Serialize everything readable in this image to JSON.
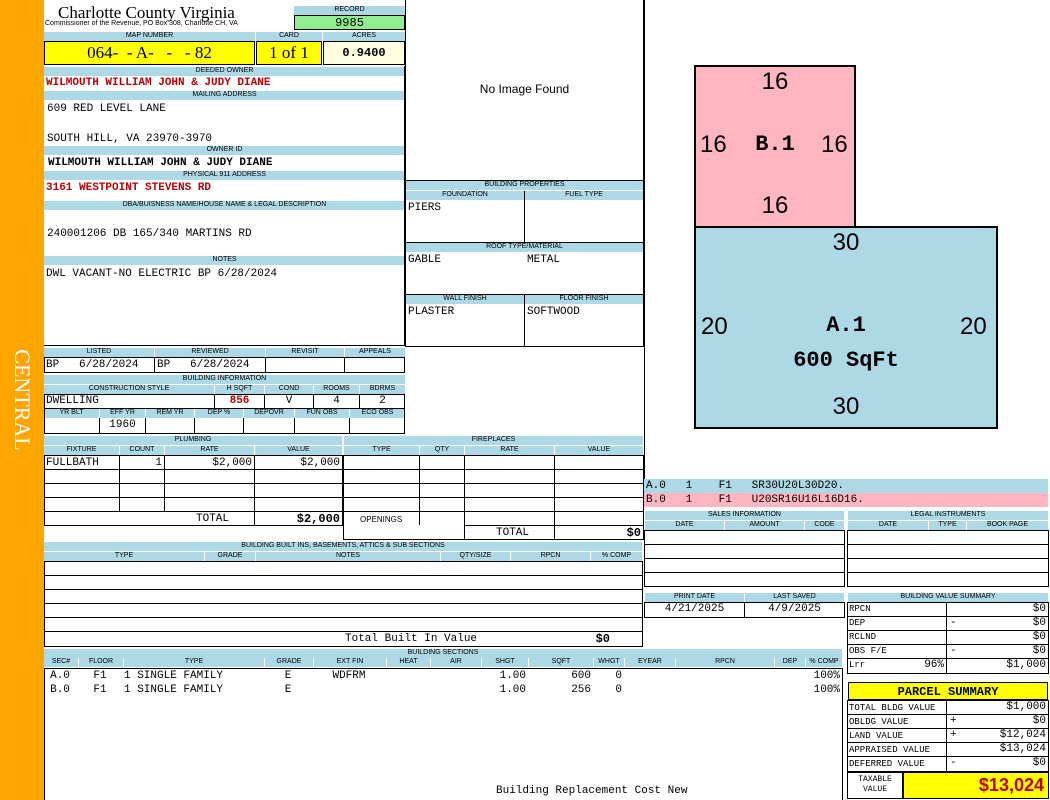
{
  "sidebar": {
    "label": "CENTRAL",
    "color": "#ffa500"
  },
  "header": {
    "title": "Charlotte County Virginia",
    "subtitle": "Commissioner of the Revenue, PO Box 308, Charlotte CH, VA",
    "record_label": "RECORD",
    "record_value": "9985",
    "map_label": "MAP NUMBER",
    "map_value": "064-  - A-   -   - 82",
    "card_label": "CARD",
    "card_value": "1 of 1",
    "acres_label": "ACRES",
    "acres_value": "0.9400"
  },
  "owner": {
    "deeded_label": "DEEDED OWNER",
    "deeded_value": "WILMOUTH WILLIAM JOHN & JUDY DIANE",
    "mailing_label": "MAILING ADDRESS",
    "mailing_line1": "609 RED LEVEL LANE",
    "mailing_line2": "SOUTH HILL, VA 23970-3970",
    "owner_id_label": "OWNER ID",
    "owner_id_value": "WILMOUTH WILLIAM JOHN & JUDY DIANE",
    "physical_label": "PHYSICAL 911 ADDRESS",
    "physical_value": "3161 WESTPOINT STEVENS RD",
    "dba_label": "DBA/BUISNESS NAME/HOUSE NAME & LEGAL DESCRIPTION",
    "dba_value": "240001206 DB 165/340 MARTINS RD",
    "notes_label": "NOTES",
    "notes_value": "DWL VACANT-NO ELECTRIC BP 6/28/2024"
  },
  "image": {
    "placeholder": "No Image Found"
  },
  "building_properties": {
    "title": "BUILDING PROPERTIES",
    "foundation_label": "FOUNDATION",
    "foundation_value": "PIERS",
    "fuel_label": "FUEL TYPE",
    "fuel_value": "",
    "roof_label": "ROOF TYPE/MATERIAL",
    "roof_type": "GABLE",
    "roof_material": "METAL",
    "wall_label": "WALL FINISH",
    "wall_value": "PLASTER",
    "floor_label": "FLOOR FINISH",
    "floor_value": "SOFTWOOD"
  },
  "sketch": {
    "b1": {
      "label": "B.1",
      "top": "16",
      "left": "16",
      "right": "16",
      "bottom": "16",
      "color": "#ffb6c1"
    },
    "a1": {
      "label": "A.1",
      "area": "600 SqFt",
      "top": "30",
      "left": "20",
      "right": "20",
      "bottom": "30",
      "color": "#add8e6"
    },
    "legend": [
      {
        "text": "A.0   1    F1   SR30U20L30D20.",
        "color": "#add8e6"
      },
      {
        "text": "B.0   1    F1   U20SR16U16L16D16.",
        "color": "#ffb6c1"
      }
    ]
  },
  "review": {
    "listed_label": "LISTED",
    "listed_value": "BP   6/28/2024",
    "reviewed_label": "REVIEWED",
    "reviewed_value": "BP   6/28/2024",
    "revisit_label": "REVISIT",
    "appeals_label": "APPEALS"
  },
  "building_info": {
    "title": "BUILDING INFORMATION",
    "style_label": "CONSTRUCTION STYLE",
    "style_value": "DWELLING",
    "hsqft_label": "H SQFT",
    "hsqft_value": "856",
    "cond_label": "COND",
    "cond_value": "V",
    "rooms_label": "ROOMS",
    "rooms_value": "4",
    "bdrms_label": "BDRMS",
    "bdrms_value": "2",
    "yrblt_label": "YR BLT",
    "effyr_label": "EFF YR",
    "effyr_value": "1960",
    "remyr_label": "REM YR",
    "dep_label": "DEP %",
    "depovr_label": "DEPOVR",
    "funobs_label": "FUN OBS",
    "ecoobs_label": "ECO OBS"
  },
  "plumbing": {
    "title": "PLUMBING",
    "cols": [
      "FIXTURE",
      "COUNT",
      "RATE",
      "VALUE"
    ],
    "row_fixture": "FULLBATH",
    "row_count": "1",
    "row_rate": "$2,000",
    "row_value": "$2,000",
    "total_label": "TOTAL",
    "total_value": "$2,000"
  },
  "fireplaces": {
    "title": "FIREPLACES",
    "cols": [
      "TYPE",
      "QTY",
      "RATE",
      "VALUE"
    ],
    "openings_label": "OPENINGS",
    "total_label": "TOTAL",
    "total_value": "$0"
  },
  "sales": {
    "title": "SALES INFORMATION",
    "cols": [
      "DATE",
      "AMOUNT",
      "CODE"
    ]
  },
  "legal": {
    "title": "LEGAL INSTRUMENTS",
    "cols": [
      "DATE",
      "TYPE",
      "BOOK PAGE"
    ]
  },
  "print": {
    "print_label": "PRINT DATE",
    "print_value": "4/21/2025",
    "saved_label": "LAST SAVED",
    "saved_value": "4/9/2025"
  },
  "builtins": {
    "title": "BUILDING BUILT INS, BASEMENTS, ATTICS & SUB SECTIONS",
    "cols": [
      "TYPE",
      "GRADE",
      "NOTES",
      "QTY/SIZE",
      "RPCN",
      "% COMP"
    ],
    "total_label": "Total Built In Value",
    "total_value": "$0"
  },
  "value_summary": {
    "title": "BUILDING VALUE SUMMARY",
    "rpcn_label": "RPCN",
    "rpcn_value": "$0",
    "dep_label": "DEP",
    "dep_sign": "-",
    "dep_value": "$0",
    "rclnd_label": "RCLND",
    "rclnd_value": "$0",
    "obs_label": "OBS F/E",
    "obs_sign": "-",
    "obs_value": "$0",
    "lrr_label": "Lrr",
    "lrr_pct": "96%",
    "lrr_value": "$1,000"
  },
  "parcel_summary": {
    "title": "PARCEL SUMMARY",
    "total_bldg_label": "TOTAL BLDG VALUE",
    "total_bldg_value": "$1,000",
    "obldg_label": "OBLDG VALUE",
    "obldg_sign": "+",
    "obldg_value": "$0",
    "land_label": "LAND VALUE",
    "land_sign": "+",
    "land_value": "$12,024",
    "appraised_label": "APPRAISED VALUE",
    "appraised_value": "$13,024",
    "deferred_label": "DEFERRED VALUE",
    "deferred_sign": "-",
    "deferred_value": "$0",
    "taxable_label1": "TAXABLE",
    "taxable_label2": "VALUE",
    "taxable_value": "$13,024"
  },
  "sections": {
    "title": "BUILDING SECTIONS",
    "cols": [
      "SEC#",
      "FLOOR",
      "TYPE",
      "GRADE",
      "EXT FIN",
      "HEAT",
      "AIR",
      "SHGT",
      "SQFT",
      "WHGT",
      "EYEAR",
      "RPCN",
      "DEP",
      "% COMP"
    ],
    "rows": [
      {
        "sec": "A.0",
        "floor": "F1",
        "type": "1 SINGLE FAMILY",
        "grade": "E",
        "ext": "WDFRM",
        "heat": "",
        "air": "",
        "shgt": "1.00",
        "sqft": "600",
        "whgt": "0",
        "eyear": "",
        "rpcn": "",
        "dep": "",
        "comp": "100%"
      },
      {
        "sec": "B.0",
        "floor": "F1",
        "type": "1 SINGLE FAMILY",
        "grade": "E",
        "ext": "",
        "heat": "",
        "air": "",
        "shgt": "1.00",
        "sqft": "256",
        "whgt": "0",
        "eyear": "",
        "rpcn": "",
        "dep": "",
        "comp": "100%"
      }
    ],
    "footer": "Building Replacement Cost New"
  }
}
